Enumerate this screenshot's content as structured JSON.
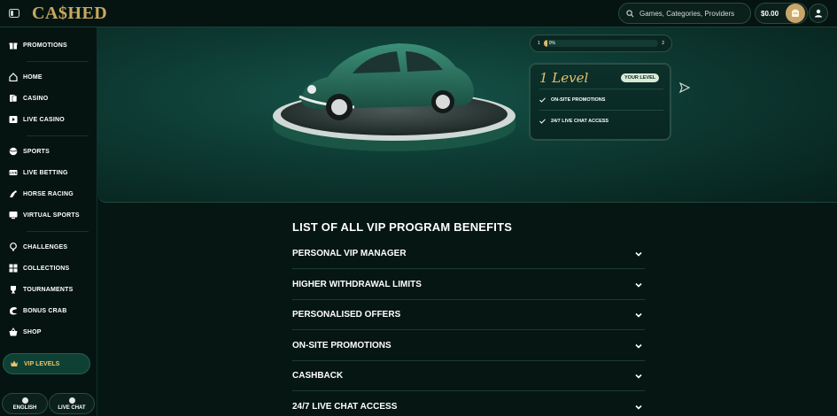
{
  "header": {
    "logo": "CA$HED",
    "search_placeholder": "Games, Categories, Providers",
    "balance": "$0.00"
  },
  "sidebar": {
    "promotions": "PROMOTIONS",
    "items_group1": [
      {
        "label": "HOME",
        "icon": "home-icon"
      },
      {
        "label": "CASINO",
        "icon": "cards-icon"
      },
      {
        "label": "LIVE CASINO",
        "icon": "live-casino-icon"
      }
    ],
    "items_group2": [
      {
        "label": "SPORTS",
        "icon": "ball-icon"
      },
      {
        "label": "LIVE BETTING",
        "icon": "live-betting-icon"
      },
      {
        "label": "HORSE RACING",
        "icon": "horse-icon"
      },
      {
        "label": "VIRTUAL SPORTS",
        "icon": "virtual-sports-icon"
      }
    ],
    "items_group3": [
      {
        "label": "CHALLENGES",
        "icon": "trophy-challenge-icon"
      },
      {
        "label": "COLLECTIONS",
        "icon": "collections-icon"
      },
      {
        "label": "TOURNAMENTS",
        "icon": "trophy-icon"
      },
      {
        "label": "BONUS CRAB",
        "icon": "crab-icon"
      },
      {
        "label": "SHOP",
        "icon": "basket-icon"
      }
    ],
    "vip": "VIP LEVELS",
    "language": "ENGLISH",
    "live_chat": "LIVE CHAT"
  },
  "hero": {
    "progress": {
      "start": "1",
      "end": "2",
      "percent_label": "0%",
      "percent": 0
    },
    "level_card": {
      "title": "1 Level",
      "badge": "YOUR LEVEL",
      "benefits": [
        "ON-SITE PROMOTIONS",
        "24/7 LIVE CHAT ACCESS"
      ]
    }
  },
  "benefits_section": {
    "title": "LIST OF ALL VIP PROGRAM BENEFITS",
    "items": [
      "PERSONAL VIP MANAGER",
      "HIGHER WITHDRAWAL LIMITS",
      "PERSONALISED OFFERS",
      "ON-SITE PROMOTIONS",
      "CASHBACK",
      "24/7 LIVE CHAT ACCESS"
    ]
  },
  "colors": {
    "accent_gold": "#e1b866",
    "background": "#061613",
    "hero_green": "#0d3a32"
  }
}
